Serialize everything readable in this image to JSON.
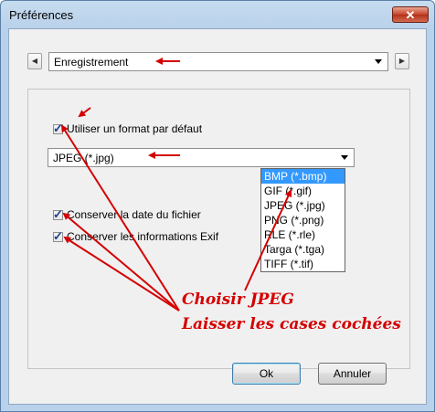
{
  "window": {
    "title": "Préférences",
    "close_glyph": "✕"
  },
  "nav": {
    "prev_glyph": "◀",
    "next_glyph": "▶"
  },
  "category": {
    "value": "Enregistrement"
  },
  "default_format": {
    "label": "Utiliser un format par défaut",
    "checked": true
  },
  "format_select": {
    "value": "JPEG (*.jpg)",
    "options": [
      "BMP (*.bmp)",
      "GIF (*.gif)",
      "JPEG (*.jpg)",
      "PNG (*.png)",
      "RLE (*.rle)",
      "Targa (*.tga)",
      "TIFF (*.tif)"
    ],
    "highlighted": "BMP (*.bmp)"
  },
  "keep_date": {
    "label": "Conserver la date du fichier",
    "checked": true
  },
  "keep_exif": {
    "label": "Conserver les informations Exif",
    "checked": true
  },
  "buttons": {
    "ok": "Ok",
    "cancel": "Annuler"
  },
  "annotations": {
    "line1": "Choisir JPEG",
    "line2": "Laisser les cases cochées",
    "color": "#d40000"
  }
}
